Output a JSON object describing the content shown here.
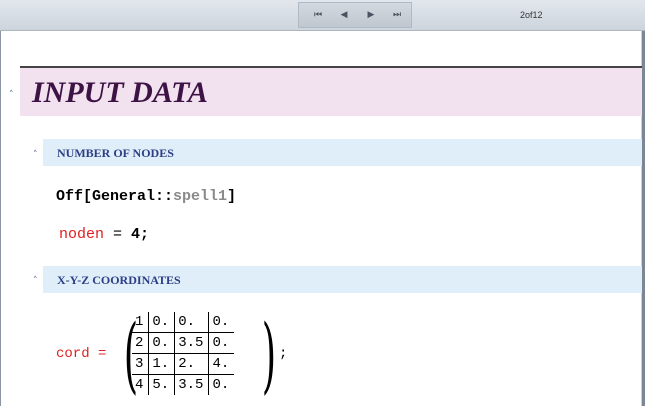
{
  "toolbar": {
    "nav_first": "⏮",
    "nav_prev": "◀",
    "nav_next": "▶",
    "nav_last": "⏭",
    "page_counter": "2of12"
  },
  "section": {
    "title": "INPUT DATA",
    "toggle": "˄"
  },
  "subsections": [
    {
      "title": "NUMBER OF NODES",
      "toggle": "˄"
    },
    {
      "title": "X-Y-Z COORDINATES",
      "toggle": "˄"
    }
  ],
  "cells": {
    "off_func": "Off[General::",
    "off_arg": "spell1",
    "off_close": "]",
    "noden_var": "noden",
    "noden_eq": " = ",
    "noden_val": "4",
    "noden_semicolon": ";",
    "cord_label": "cord =",
    "semicolon": ";"
  },
  "matrix": {
    "rows": [
      [
        "1",
        "0.",
        "0.",
        "0."
      ],
      [
        "2",
        "0.",
        "3.5",
        "0."
      ],
      [
        "3",
        "1.",
        "2.",
        "4."
      ],
      [
        "4",
        "5.",
        "3.5",
        "0."
      ]
    ]
  },
  "colors": {
    "section_bg": "#f2e1ee",
    "section_text": "#3d1346",
    "subsection_bg": "#dfeef8",
    "subsection_text": "#2c3f86",
    "code_red": "#e02020"
  }
}
